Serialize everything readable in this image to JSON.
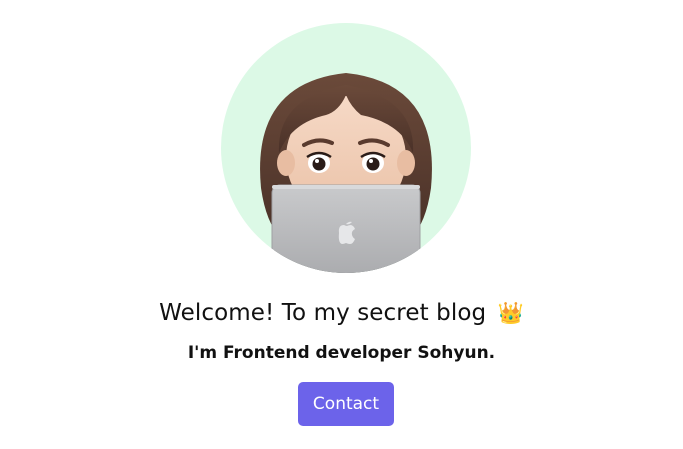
{
  "hero": {
    "avatar_alt": "memoji avatar with laptop",
    "title_text": "Welcome! To my secret blog",
    "title_emoji": "👑",
    "subtitle": "I'm Frontend developer Sohyun.",
    "contact_label": "Contact"
  },
  "colors": {
    "avatar_bg": "#dcf9e6",
    "button_bg": "#6c63ea",
    "button_text": "#ffffff",
    "text": "#111111"
  },
  "icons": {
    "avatar": "memoji-icon",
    "crown": "crown-icon",
    "laptop_logo": "apple-logo-icon"
  }
}
